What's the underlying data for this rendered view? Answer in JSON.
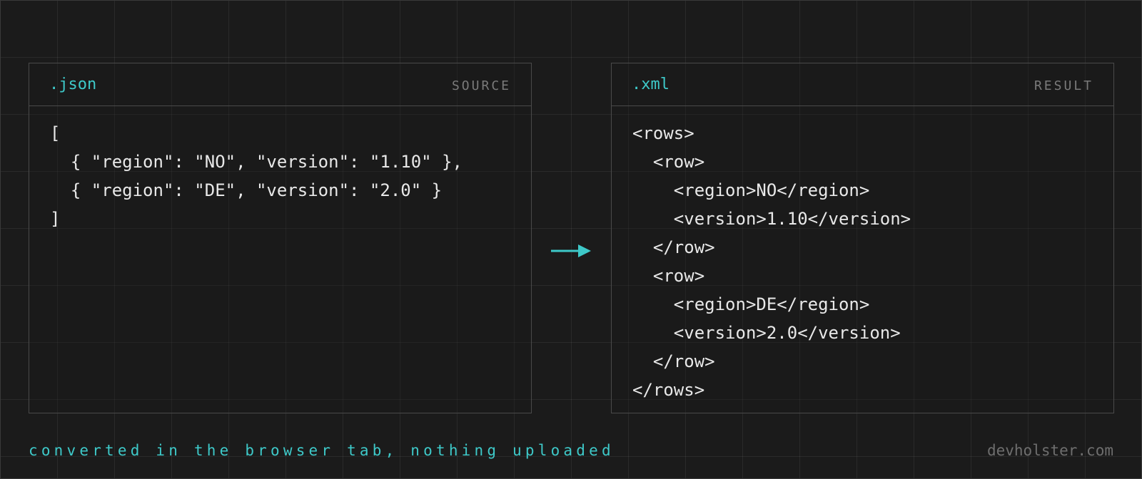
{
  "source_panel": {
    "extension": ".json",
    "role_label": "SOURCE",
    "lines": [
      "[",
      "  { \"region\": \"NO\", \"version\": \"1.10\" },",
      "  { \"region\": \"DE\", \"version\": \"2.0\" }",
      "]"
    ]
  },
  "result_panel": {
    "extension": ".xml",
    "role_label": "RESULT",
    "lines": [
      "<rows>",
      "  <row>",
      "    <region>NO</region>",
      "    <version>1.10</version>",
      "  </row>",
      "  <row>",
      "    <region>DE</region>",
      "    <version>2.0</version>",
      "  </row>",
      "</rows>"
    ]
  },
  "arrow_icon": "arrow-right-icon",
  "footer": {
    "tagline": "converted in the browser tab, nothing uploaded",
    "domain": "devholster.com"
  },
  "colors": {
    "accent": "#3ec9c9",
    "background": "#1b1b1b",
    "code_text": "#e8e8e8",
    "muted": "#7a7a7a",
    "border": "#4a4a4a"
  }
}
